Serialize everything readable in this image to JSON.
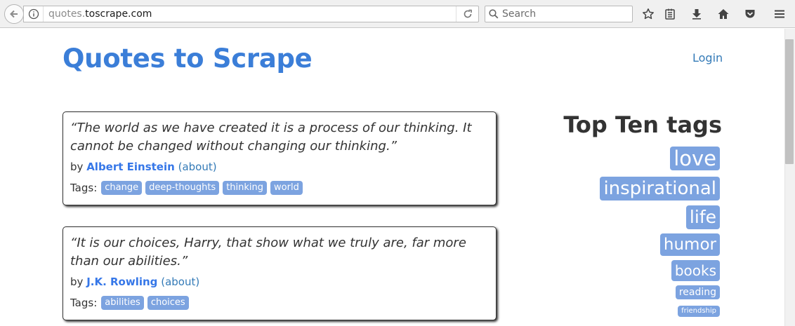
{
  "browser": {
    "url_prefix": "quotes.",
    "url_host": "toscrape.com",
    "search_placeholder": "Search"
  },
  "site": {
    "title": "Quotes to Scrape",
    "login_label": "Login"
  },
  "quotes": [
    {
      "text": "“The world as we have created it is a process of our thinking. It cannot be changed without changing our thinking.”",
      "by_label": "by",
      "author": "Albert Einstein",
      "about_label": "(about)",
      "tags_label": "Tags:",
      "tags": [
        "change",
        "deep-thoughts",
        "thinking",
        "world"
      ]
    },
    {
      "text": "“It is our choices, Harry, that show what we truly are, far more than our abilities.”",
      "by_label": "by",
      "author": "J.K. Rowling",
      "about_label": "(about)",
      "tags_label": "Tags:",
      "tags": [
        "abilities",
        "choices"
      ]
    }
  ],
  "top_tags": {
    "title": "Top Ten tags",
    "items": [
      "love",
      "inspirational",
      "life",
      "humor",
      "books",
      "reading",
      "friendship"
    ]
  },
  "colors": {
    "accent": "#3b7ed8",
    "tag_bg": "#7ca3e0",
    "text": "#333333"
  }
}
